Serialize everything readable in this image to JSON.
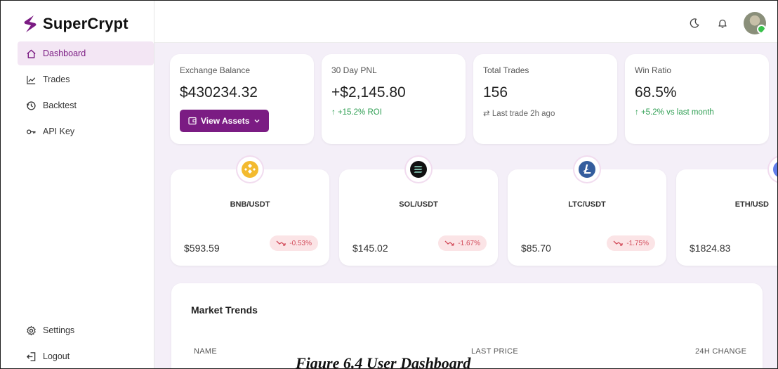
{
  "brand": {
    "name": "SuperCrypt",
    "accent": "#7b1c83"
  },
  "nav": {
    "items": [
      {
        "label": "Dashboard",
        "icon": "home-icon",
        "active": true
      },
      {
        "label": "Trades",
        "icon": "chart-line-icon"
      },
      {
        "label": "Backtest",
        "icon": "history-icon"
      },
      {
        "label": "API Key",
        "icon": "key-icon"
      }
    ],
    "bottom": [
      {
        "label": "Settings",
        "icon": "gear-icon"
      },
      {
        "label": "Logout",
        "icon": "logout-icon"
      }
    ]
  },
  "topbar": {
    "icons": [
      "moon-icon",
      "bell-icon",
      "avatar"
    ]
  },
  "stats": [
    {
      "label": "Exchange Balance",
      "value": "$430234.32",
      "button": "View Assets"
    },
    {
      "label": "30 Day PNL",
      "value": "+$2,145.80",
      "sub": "↑ +15.2% ROI",
      "sub_color": "#2e9e52"
    },
    {
      "label": "Total Trades",
      "value": "156",
      "sub": "⇄ Last trade 2h ago",
      "sub_color": "#666666"
    },
    {
      "label": "Win Ratio",
      "value": "68.5%",
      "sub": "↑ +5.2% vs last month",
      "sub_color": "#2e9e52"
    }
  ],
  "coins": [
    {
      "pair": "BNB/USDT",
      "price": "$593.59",
      "change": "-0.53%",
      "icon": "bnb-icon",
      "color": "#f3ba2f"
    },
    {
      "pair": "SOL/USDT",
      "price": "$145.02",
      "change": "-1.67%",
      "icon": "sol-icon",
      "color": "#111111"
    },
    {
      "pair": "LTC/USDT",
      "price": "$85.70",
      "change": "-1.75%",
      "icon": "ltc-icon",
      "color": "#345d9d"
    },
    {
      "pair": "ETH/USD",
      "price": "$1824.83",
      "change": "",
      "icon": "eth-icon",
      "color": "#627eea"
    }
  ],
  "trends": {
    "title": "Market Trends",
    "columns": [
      "NAME",
      "LAST PRICE",
      "24H CHANGE"
    ]
  },
  "caption": "Figure 6.4 User Dashboard"
}
